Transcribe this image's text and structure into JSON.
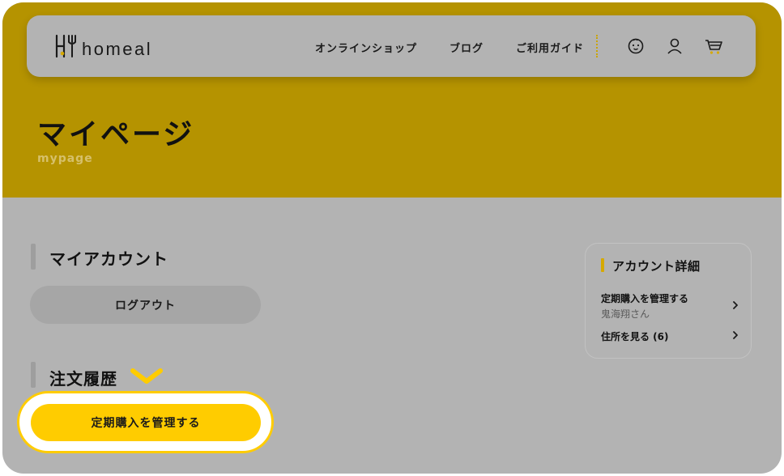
{
  "header": {
    "logo_text": "homeal",
    "nav": [
      "オンラインショップ",
      "ブログ",
      "ご利用ガイド"
    ],
    "icons": [
      "baby-face-icon",
      "user-icon",
      "cart-icon"
    ]
  },
  "hero": {
    "title": "マイページ",
    "subtitle": "mypage"
  },
  "my_account": {
    "heading": "マイアカウント",
    "logout_label": "ログアウト"
  },
  "order_history": {
    "heading": "注文履歴",
    "subscription_button": "定期購入を管理する"
  },
  "account_details": {
    "title": "アカウント詳細",
    "items": [
      {
        "label": "定期購入を管理する",
        "sub": "鬼海翔さん"
      },
      {
        "label": "住所を見る (6)"
      }
    ]
  },
  "colors": {
    "hero_gold": "#b59300",
    "overlay_gray": "#b3b3b3",
    "accent_yellow": "#ffcc00",
    "subtitle_gold": "#d6c06a"
  }
}
